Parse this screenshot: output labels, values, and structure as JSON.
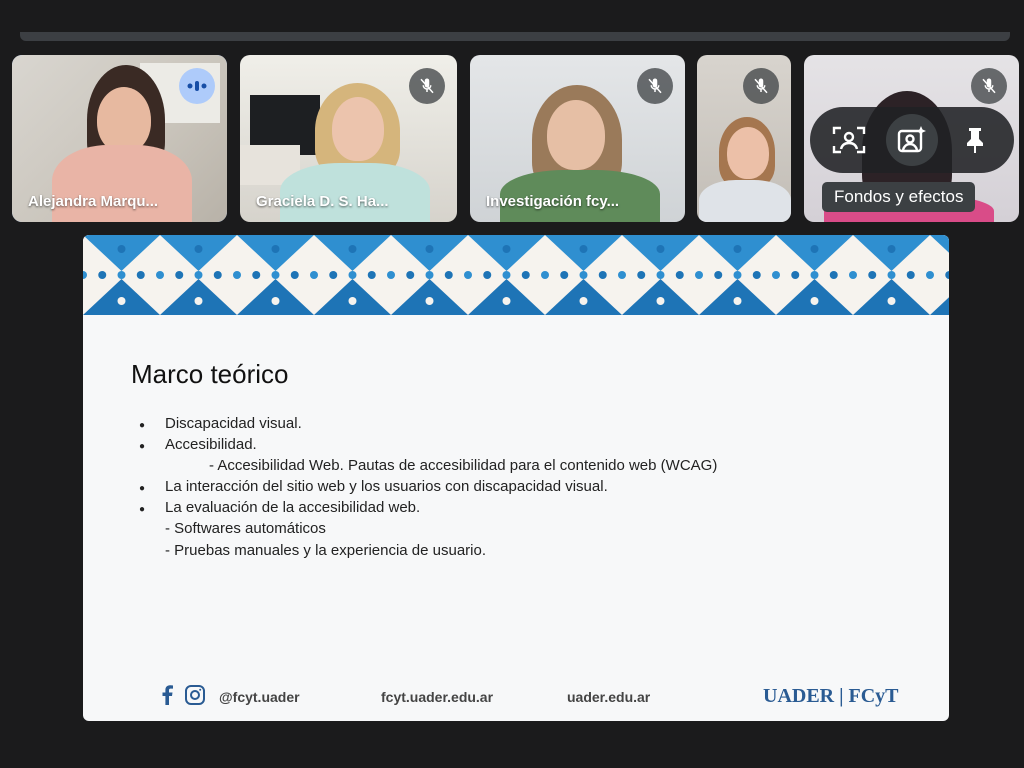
{
  "participants": [
    {
      "name": "Alejandra Marqu...",
      "state": "speaking"
    },
    {
      "name": "Graciela D. S. Ha...",
      "state": "muted"
    },
    {
      "name": "Investigación fcy...",
      "state": "muted"
    },
    {
      "name": "",
      "state": "muted"
    },
    {
      "name": "",
      "state": "muted"
    }
  ],
  "hover_toolbar": {
    "icons": [
      "framing-icon",
      "backgrounds-effects-icon",
      "pin-icon"
    ],
    "tooltip": "Fondos y efectos"
  },
  "slide": {
    "title": "Marco teórico",
    "bullets": {
      "b1": "Discapacidad visual.",
      "b2": "Accesibilidad.",
      "b2_sub": "- Accesibilidad Web. Pautas de accesibilidad para el contenido  web (WCAG)",
      "b3": "La interacción del sitio web y los usuarios con discapacidad visual.",
      "b4": "La evaluación de la accesibilidad web.",
      "b4_sub1": "- Softwares automáticos",
      "b4_sub2": "- Pruebas manuales y la experiencia de usuario."
    },
    "bullet_symbol": "●",
    "footer": {
      "social_icons": [
        "facebook-icon",
        "instagram-icon"
      ],
      "handle": "@fcyt.uader",
      "site1": "fcyt.uader.edu.ar",
      "site2": "uader.edu.ar",
      "logo_text": "UADER | FCyT"
    },
    "colors": {
      "accent": "#2f8fd0",
      "accent_dark": "#1e74b6"
    }
  }
}
